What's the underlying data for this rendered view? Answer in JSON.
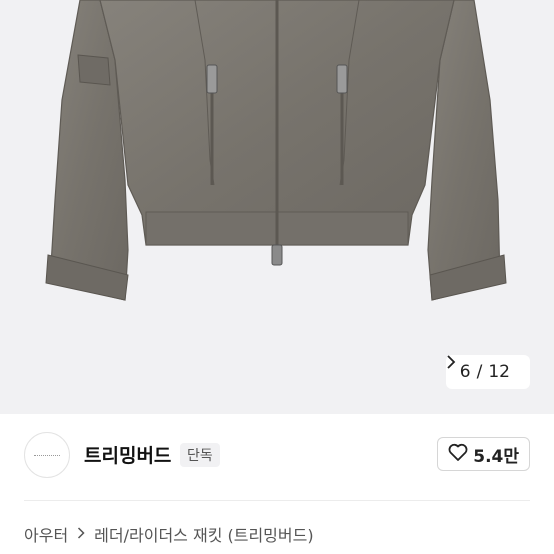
{
  "gallery": {
    "current": "6",
    "separator": "/",
    "total": "12",
    "next_icon": "chevron-right-icon"
  },
  "seller": {
    "name": "트리밍버드",
    "badge": "단독"
  },
  "like": {
    "icon": "heart-outline-icon",
    "count": "5.4만"
  },
  "breadcrumb": {
    "category": "아우터",
    "separator_icon": "chevron-right-icon",
    "subcategory": "레더/라이더스 재킷 (트리밍버드)"
  },
  "colors": {
    "hero_background": "#f1f1f3",
    "jacket": "#7a7670",
    "text_primary": "#111111",
    "text_secondary": "#555555"
  }
}
